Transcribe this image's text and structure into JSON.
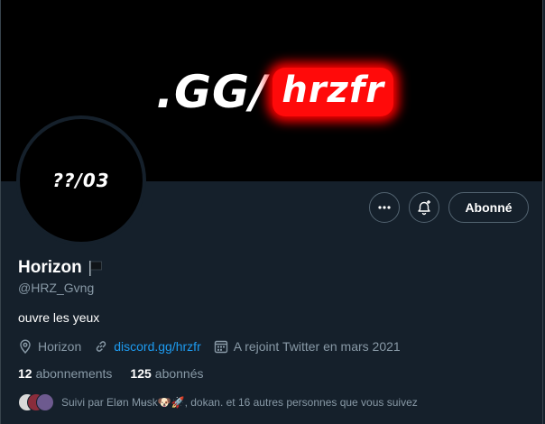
{
  "banner": {
    "prefix": ".GG/",
    "highlight": "hrzfr",
    "highlight_color": "#ff0a0a"
  },
  "avatar": {
    "text": "??/03"
  },
  "actions": {
    "more_icon": "more-horizontal-icon",
    "bell_icon": "bell-plus-icon",
    "follow_label": "Abonné"
  },
  "profile": {
    "name": "Horizon",
    "flag_icon": "black-flag-icon",
    "handle": "@HRZ_Gvng",
    "bio": "ouvre les yeux",
    "location": "Horizon",
    "website": "discord.gg/hrzfr",
    "joined": "A rejoint Twitter en mars 2021"
  },
  "stats": {
    "following_count": "12",
    "following_label": "abonnements",
    "followers_count": "125",
    "followers_label": "abonnés"
  },
  "followed_by": {
    "text": "Suivi par Eløn Mʉsk🐶🚀, dokan. et 16 autres personnes que vous suivez"
  },
  "colors": {
    "background": "#15202b",
    "accent": "#1d9bf0",
    "secondary_text": "#8899a6"
  }
}
